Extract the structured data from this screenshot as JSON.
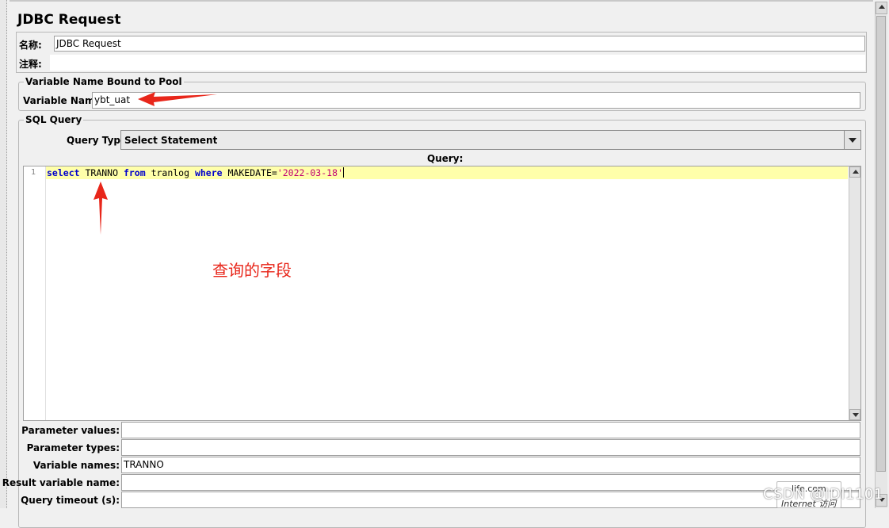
{
  "panel": {
    "title": "JDBC Request"
  },
  "name_section": {
    "name_label": "名称:",
    "name_value": "JDBC Request",
    "comment_label": "注释:",
    "comment_value": ""
  },
  "pool_section": {
    "legend": "Variable Name Bound to Pool",
    "variable_name_label": "Variable Name:",
    "variable_name_value": "ybt_uat"
  },
  "sql_section": {
    "legend": "SQL Query",
    "query_type_label": "Query Type:",
    "query_type_value": "Select Statement",
    "query_label": "Query:",
    "line_number": "1",
    "code_tokens": {
      "t1": "select",
      "t2": " TRANNO ",
      "t3": "from",
      "t4": " tranlog ",
      "t5": "where",
      "t6": " MAKEDATE=",
      "t7": "'2022-03-18'"
    }
  },
  "params": {
    "parameter_values_label": "Parameter values:",
    "parameter_values_value": "",
    "parameter_types_label": "Parameter types:",
    "parameter_types_value": "",
    "variable_names_label": "Variable names:",
    "variable_names_value": "TRANNO",
    "result_variable_name_label": "Result variable name:",
    "result_variable_name_value": "",
    "query_timeout_label": "Query timeout (s):",
    "query_timeout_value": ""
  },
  "annotation": {
    "text": "查询的字段",
    "color": "#e8261a"
  },
  "overlay": {
    "watermark": "CSDN @IDI1101",
    "popup_line1": "life.com...",
    "popup_line2": "Internet 访问"
  },
  "colors": {
    "current_line": "#ffffaa",
    "keyword": "#0000cc",
    "string": "#c00073"
  }
}
